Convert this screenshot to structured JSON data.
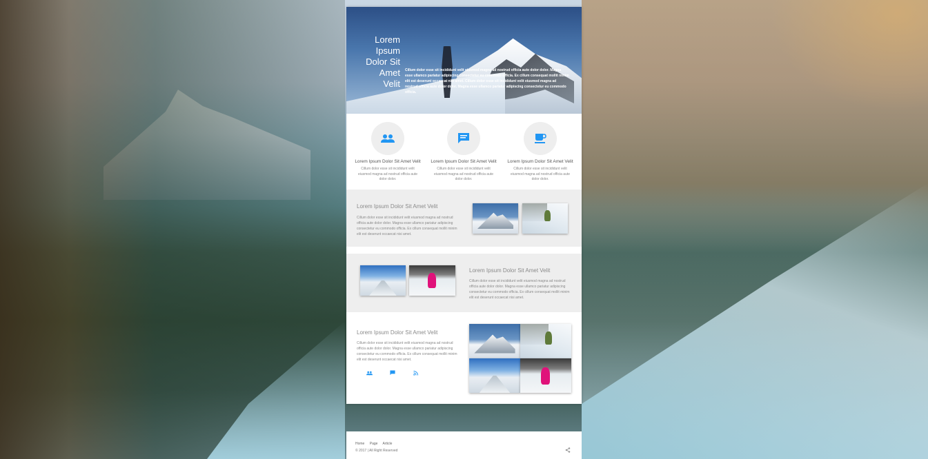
{
  "hero": {
    "title_lines": [
      "Lorem",
      "Ipsum",
      "Dolor Sit",
      "Amet",
      "Velit"
    ],
    "text": "Cillum dolor esse sit incididunt velit eiusmod magna ad nostrud officia aute dolor dolor. Magna esse ullamco pariatur adipiscing consectetur eu commodo officia. Ex cillum consequat mollit minim elit est deserunt occaecat nisi amet. Cillum dolor esse sit incididunt velit eiusmod magna ad nostrud officia aute dolor dolor. Magna esse ullamco pariatur adipiscing consectetur eu commodo officia."
  },
  "features": [
    {
      "icon": "people-icon",
      "title": "Lorem Ipsum Dolor Sit Amet Velit",
      "text": "Cillum dolor esse sit incididunt velit eiusmod magna ad nostrud officia aute dolor dolor."
    },
    {
      "icon": "chat-icon",
      "title": "Lorem Ipsum Dolor Sit Amet Velit",
      "text": "Cillum dolor esse sit incididunt velit eiusmod magna ad nostrud officia aute dolor dolor."
    },
    {
      "icon": "coffee-icon",
      "title": "Lorem Ipsum Dolor Sit Amet Velit",
      "text": "Cillum dolor esse sit incididunt velit eiusmod magna ad nostrud officia aute dolor dolor."
    }
  ],
  "sections": [
    {
      "title": "Lorem Ipsum Dolor Sit Amet Velit",
      "text": "Cillum dolor esse sit incididunt velit eiusmod magna ad nostrud officia aute dolor dolor. Magna esse ullamco pariatur adipiscing consectetur eu commodo officia. Ex cillum consequat mollit minim elit est deserunt occaecat nisi amet."
    },
    {
      "title": "Lorem Ipsum Dolor Sit Amet Velit",
      "text": "Cillum dolor esse sit incididunt velit eiusmod magna ad nostrud officia aute dolor dolor. Magna esse ullamco pariatur adipiscing consectetur eu commodo officia. Ex cillum consequat mollit minim elit est deserunt occaecat nisi amet."
    },
    {
      "title": "Lorem Ipsum Dolor Sit Amet Velit",
      "text": "Cillum dolor esse sit incididunt velit eiusmod magna ad nostrud officia aute dolor dolor. Magna esse ullamco pariatur adipiscing consectetur eu commodo officia. Ex cillum consequat mollit minim elit est deserunt occaecat nisi amet."
    }
  ],
  "social_icons": [
    "people-icon",
    "chat-icon",
    "rss-icon"
  ],
  "footer": {
    "nav": [
      "Home",
      "Page",
      "Article"
    ],
    "copyright": "© 2017 | All Right Reserved",
    "share_icon": "share-icon"
  },
  "colors": {
    "accent": "#2196f3",
    "section_alt_bg": "#eeeeee",
    "page_bg": "#ffffff"
  }
}
